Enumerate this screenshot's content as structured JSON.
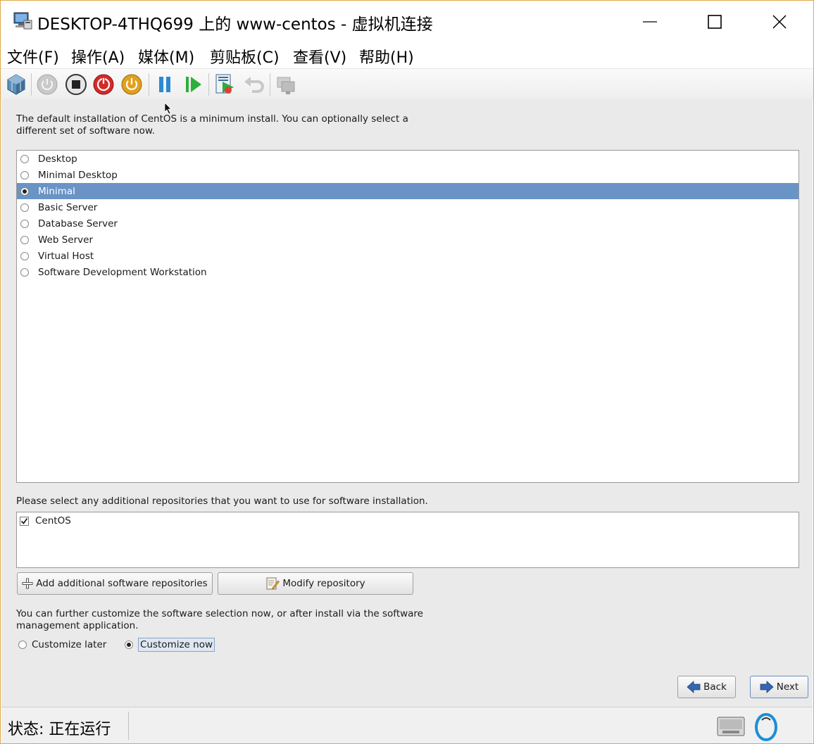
{
  "window": {
    "title": "DESKTOP-4THQ699 上的 www-centos - 虚拟机连接"
  },
  "menubar": {
    "items": [
      {
        "label": "文件(F)"
      },
      {
        "label": "操作(A)"
      },
      {
        "label": "媒体(M)"
      },
      {
        "label": "剪贴板(C)"
      },
      {
        "label": "查看(V)"
      },
      {
        "label": "帮助(H)"
      }
    ]
  },
  "toolbar": {
    "buttons": [
      "ctrl-alt-del-icon",
      "start-icon",
      "turn-off-icon",
      "shutdown-icon",
      "save-icon",
      "pause-icon",
      "resume-icon",
      "checkpoint-icon",
      "revert-icon",
      "enhanced-session-icon"
    ]
  },
  "installer": {
    "intro": "The default installation of CentOS is a minimum install. You can optionally select a different set of software now.",
    "software_options": [
      {
        "label": "Desktop",
        "selected": false
      },
      {
        "label": "Minimal Desktop",
        "selected": false
      },
      {
        "label": "Minimal",
        "selected": true
      },
      {
        "label": "Basic Server",
        "selected": false
      },
      {
        "label": "Database Server",
        "selected": false
      },
      {
        "label": "Web Server",
        "selected": false
      },
      {
        "label": "Virtual Host",
        "selected": false
      },
      {
        "label": "Software Development Workstation",
        "selected": false
      }
    ],
    "repo_prompt": "Please select any additional repositories that you want to use for software installation.",
    "repositories": [
      {
        "label": "CentOS",
        "checked": true
      }
    ],
    "add_repo_label": "Add additional software repositories",
    "modify_repo_label": "Modify repository",
    "customize_text": "You can further customize the software selection now, or after install via the software management application.",
    "customize_later_label": "Customize later",
    "customize_now_label": "Customize now",
    "customize_selected": "now",
    "back_label": "Back",
    "next_label": "Next"
  },
  "statusbar": {
    "status": "状态: 正在运行"
  },
  "colors": {
    "selection": "#6a93c6",
    "window_border": "#e0a64a"
  }
}
